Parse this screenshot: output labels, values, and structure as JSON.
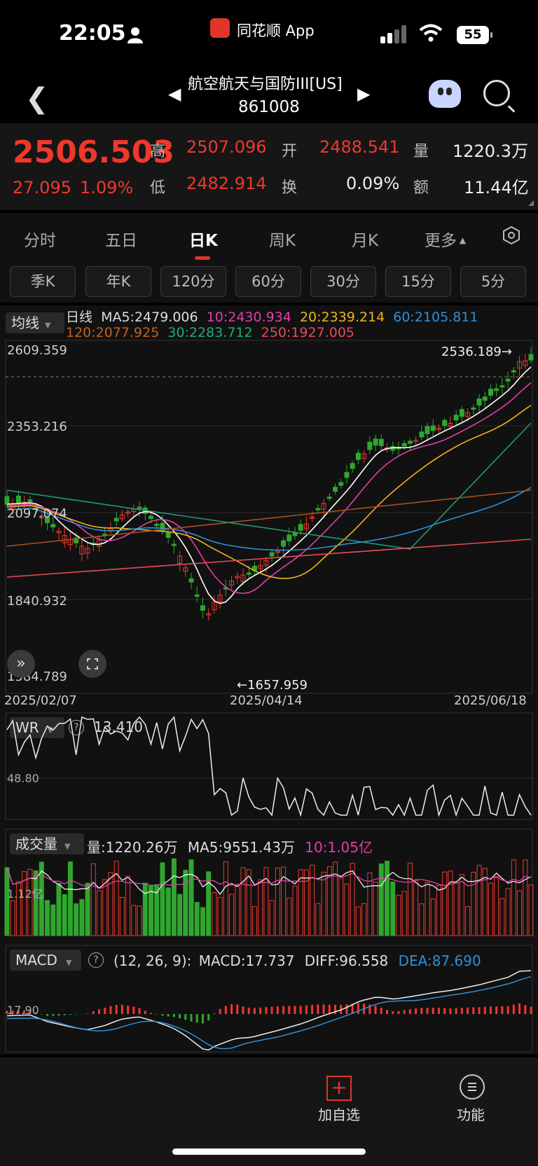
{
  "status_bar": {
    "time": "22:05",
    "app_name": "同花顺 App",
    "battery": "55"
  },
  "header": {
    "title": "航空航天与国防III[US]",
    "code": "861008"
  },
  "quote": {
    "price": "2506.503",
    "change": "27.095",
    "change_pct": "1.09%",
    "high_label": "高",
    "high": "2507.096",
    "low_label": "低",
    "low": "2482.914",
    "open_label": "开",
    "open": "2488.541",
    "turnover_label": "换",
    "turnover": "0.09%",
    "volume_label": "量",
    "volume": "1220.3万",
    "amount_label": "额",
    "amount": "11.44亿"
  },
  "tabs": [
    "分时",
    "五日",
    "日K",
    "周K",
    "月K",
    "更多"
  ],
  "subtabs": [
    "季K",
    "年K",
    "120分",
    "60分",
    "30分",
    "15分",
    "5分"
  ],
  "kline": {
    "indicator": "均线",
    "period": "日线",
    "ma5": "MA5:2479.006",
    "ma10": "10:2430.934",
    "ma20": "20:2339.214",
    "ma60": "60:2105.811",
    "ma120": "120:2077.925",
    "ma30": "30:2283.712",
    "ma250": "250:1927.005",
    "y_labels": [
      "2609.359",
      "2353.216",
      "2097.074",
      "1840.932",
      "1584.789"
    ],
    "max_marker": "2536.189→",
    "min_marker": "←1657.959",
    "dates": [
      "2025/02/07",
      "2025/04/14",
      "2025/06/18"
    ]
  },
  "wr": {
    "name": "WR",
    "value": "13.410",
    "level": "48.80"
  },
  "volume_panel": {
    "name": "成交量",
    "vol": "量:1220.26万",
    "ma5": "MA5:9551.43万",
    "ma10": "10:1.05亿",
    "level": "1.12亿"
  },
  "macd": {
    "name": "MACD",
    "params": "(12, 26, 9):",
    "macd": "MACD:17.737",
    "diff": "DIFF:96.558",
    "dea": "DEA:87.690",
    "level": "17.90"
  },
  "bottom": {
    "add": "加自选",
    "func": "功能"
  },
  "colors": {
    "up": "#f0382b",
    "down": "#2fa72f",
    "ma5": "#ffffff",
    "ma10": "#e23fa8",
    "ma20": "#f3b21c",
    "ma60": "#2f8fd8",
    "ma120": "#a9521d",
    "ma30": "#1f9c70",
    "ma250": "#e84a58"
  }
}
